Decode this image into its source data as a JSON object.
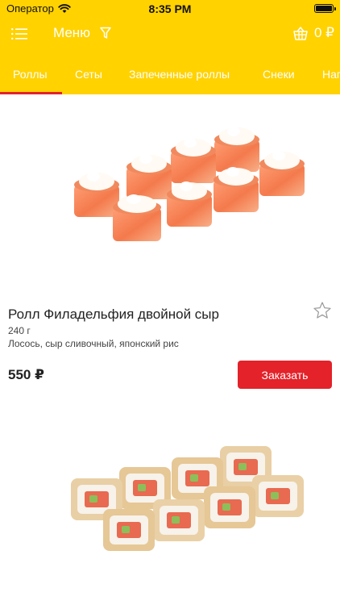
{
  "status_bar": {
    "carrier": "Оператор",
    "time": "8:35 PM"
  },
  "navbar": {
    "title": "Меню",
    "basket_amount": "0 ₽",
    "icons": [
      "menu-list-icon",
      "filter-icon",
      "basket-icon"
    ]
  },
  "tabs": [
    {
      "label": "Роллы",
      "active": true
    },
    {
      "label": "Сеты",
      "active": false
    },
    {
      "label": "Запеченные роллы",
      "active": false
    },
    {
      "label": "Снеки",
      "active": false
    },
    {
      "label": "Напитки",
      "active": false
    }
  ],
  "products": [
    {
      "title": "Ролл Филадельфия двойной сыр",
      "weight": "240 г",
      "description": "Лосось, сыр сливочный, японский рис",
      "price": "550 ₽",
      "order_label": "Заказать",
      "favorite": false
    }
  ],
  "colors": {
    "header": "#ffd200",
    "accent": "#e3222a",
    "tab_text": "#ffffff"
  }
}
